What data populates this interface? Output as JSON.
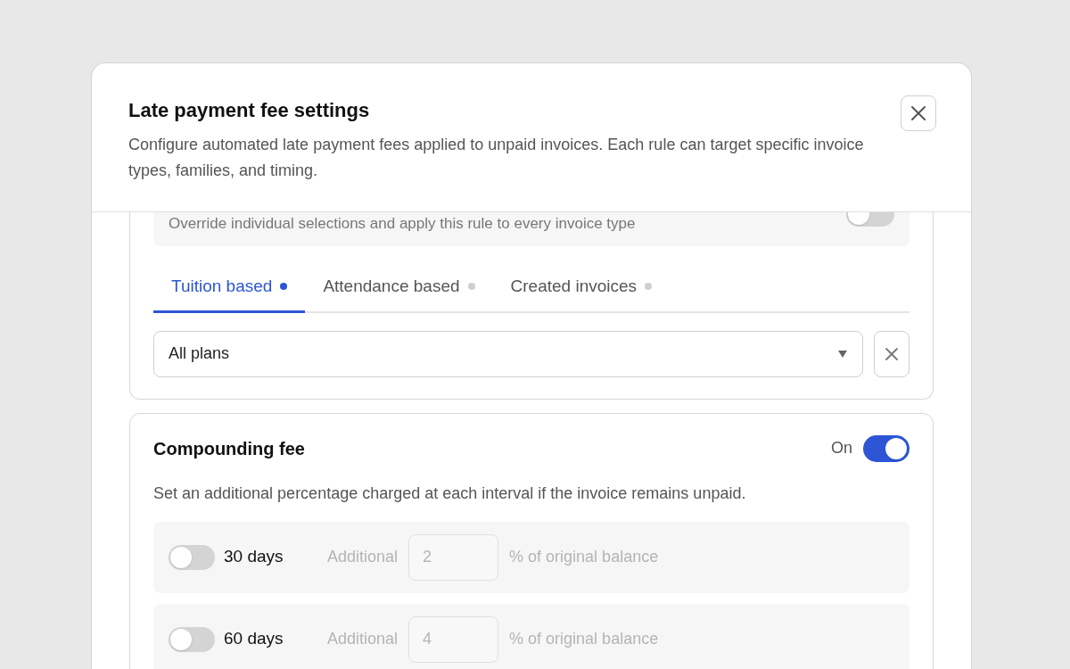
{
  "dialog": {
    "title": "Late payment fee settings",
    "description": "Configure automated late payment fees applied to unpaid invoices. Each rule can target specific invoice types, families, and timing."
  },
  "apply_all": {
    "description": "Override individual selections and apply this rule to every invoice type",
    "on": false
  },
  "tabs": [
    {
      "label": "Tuition based",
      "selected": true
    },
    {
      "label": "Attendance based",
      "selected": false
    },
    {
      "label": "Created invoices",
      "selected": false
    }
  ],
  "plan_select": {
    "value": "All plans"
  },
  "compounding_fee": {
    "title": "Compounding fee",
    "status": "On",
    "on": true,
    "description": "Set an additional percentage charged at each interval if the invoice remains unpaid.",
    "intervals": [
      {
        "label": "30 days",
        "on": false,
        "prefix": "Additional",
        "value": "2",
        "suffix": "% of original balance"
      },
      {
        "label": "60 days",
        "on": false,
        "prefix": "Additional",
        "value": "4",
        "suffix": "% of original balance"
      }
    ]
  }
}
